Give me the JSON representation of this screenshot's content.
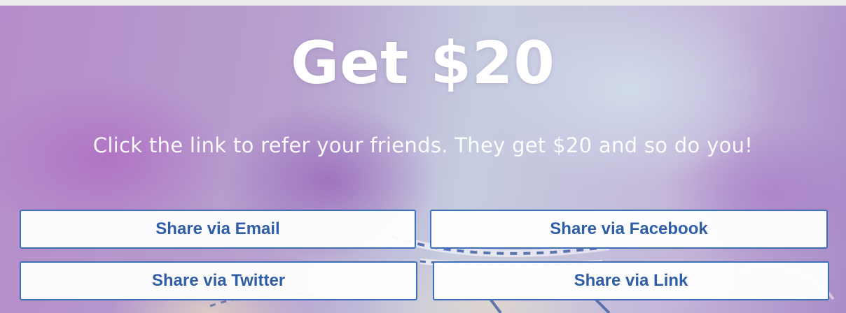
{
  "referral": {
    "headline": "Get $20",
    "subtitle": "Click the link to refer your friends. They get $20 and so do you!"
  },
  "share_buttons": {
    "email_label": "Share via Email",
    "facebook_label": "Share via Facebook",
    "twitter_label": "Share via Twitter",
    "link_label": "Share via Link"
  },
  "colors": {
    "button_text": "#2f5ea6",
    "button_border": "#3d6fb8",
    "headline_text": "#ffffff"
  }
}
